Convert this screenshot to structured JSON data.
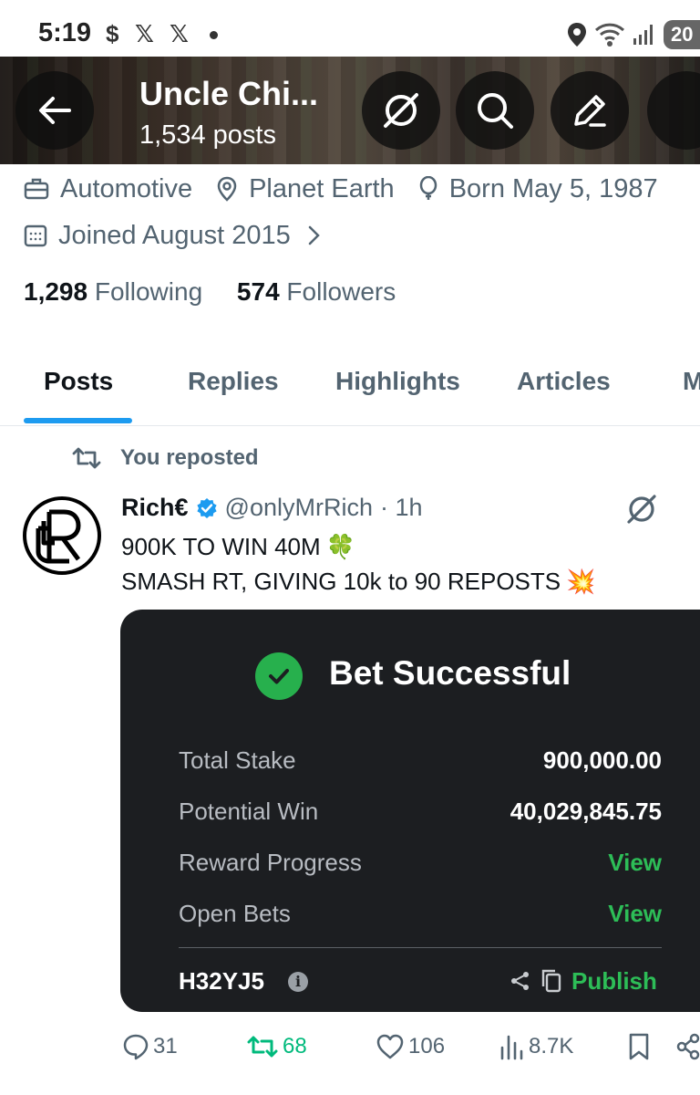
{
  "status_bar": {
    "time": "5:19",
    "app_icons": [
      "$",
      "𝕏",
      "𝕏"
    ],
    "battery": "20"
  },
  "header": {
    "title": "Uncle Chi...",
    "posts_count": "1,534 posts"
  },
  "profile": {
    "category": "Automotive",
    "location": "Planet Earth",
    "born": "Born May 5, 1987",
    "joined": "Joined August 2015",
    "following_count": "1,298",
    "following_label": "Following",
    "followers_count": "574",
    "followers_label": "Followers"
  },
  "tabs": [
    {
      "label": "Posts",
      "active": true
    },
    {
      "label": "Replies",
      "active": false
    },
    {
      "label": "Highlights",
      "active": false
    },
    {
      "label": "Articles",
      "active": false
    },
    {
      "label": "M",
      "active": false
    }
  ],
  "post": {
    "repost_label": "You reposted",
    "author": "Rich€",
    "handle": "@onlyMrRich",
    "time": "· 1h",
    "line1": "900K TO WIN 40M",
    "line2": "SMASH RT, GIVING 10k to 90 REPOSTS",
    "emoji1": "🍀",
    "emoji2": "💥"
  },
  "bet_card": {
    "title": "Bet Successful",
    "rows": [
      {
        "label": "Total Stake",
        "value": "900,000.00"
      },
      {
        "label": "Potential Win",
        "value": "40,029,845.75"
      },
      {
        "label": "Reward Progress",
        "value": "View"
      },
      {
        "label": "Open Bets",
        "value": "View"
      }
    ],
    "code": "H32YJ5",
    "publish_label": "Publish",
    "accent": "#2dbd57"
  },
  "actions": {
    "replies": "31",
    "reposts": "68",
    "likes": "106",
    "views": "8.7K"
  },
  "colors": {
    "accent_blue": "#1d9bf0",
    "repost_green": "#00ba7c",
    "muted_text": "#536471"
  }
}
